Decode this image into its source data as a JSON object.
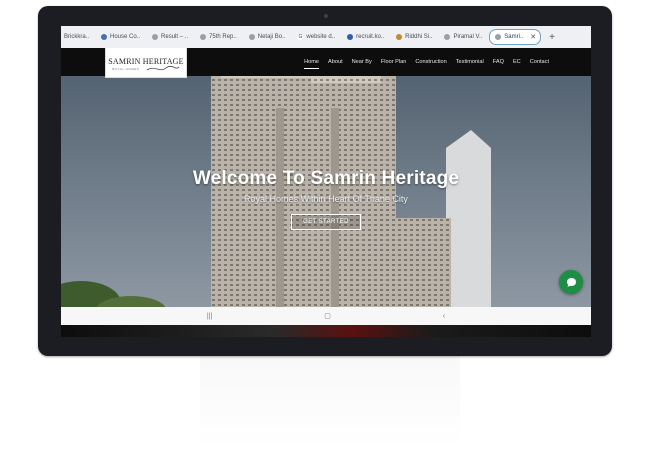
{
  "tabs": [
    {
      "label": "Brickkra..",
      "icon": "site-favicon",
      "active": false
    },
    {
      "label": "House Co..",
      "icon": "diamond-favicon",
      "active": false
    },
    {
      "label": "Result – ..",
      "icon": "site-favicon",
      "active": false
    },
    {
      "label": "75th Rep..",
      "icon": "site-favicon",
      "active": false
    },
    {
      "label": "Netaji Bo..",
      "icon": "site-favicon",
      "active": false
    },
    {
      "label": "website d..",
      "icon": "google-favicon",
      "active": false
    },
    {
      "label": "recruit.ko..",
      "icon": "site-favicon",
      "active": false
    },
    {
      "label": "Riddhi Si..",
      "icon": "site-favicon",
      "active": false
    },
    {
      "label": "Piramal V..",
      "icon": "site-favicon",
      "active": false
    },
    {
      "label": "Samri..",
      "icon": "site-favicon",
      "active": true
    }
  ],
  "logo": {
    "title": "SAMRIN HERITAGE",
    "tagline": "ROYAL HOMES"
  },
  "nav": [
    "Home",
    "About",
    "Near By",
    "Floor Plan",
    "Construction",
    "Testimonial",
    "FAQ",
    "EC",
    "Contact"
  ],
  "hero": {
    "title": "Welcome To Samrin Heritage",
    "subtitle": "Royal Homes Within Heart Of Thane City",
    "cta": "GET STARTED"
  },
  "system_nav": {
    "recent": "|||",
    "home": "▢",
    "back": "‹"
  },
  "colors": {
    "nav_bg": "#0d0d0d",
    "chat_button": "#1e8e44",
    "active_tab_border": "#6fa2c5"
  }
}
